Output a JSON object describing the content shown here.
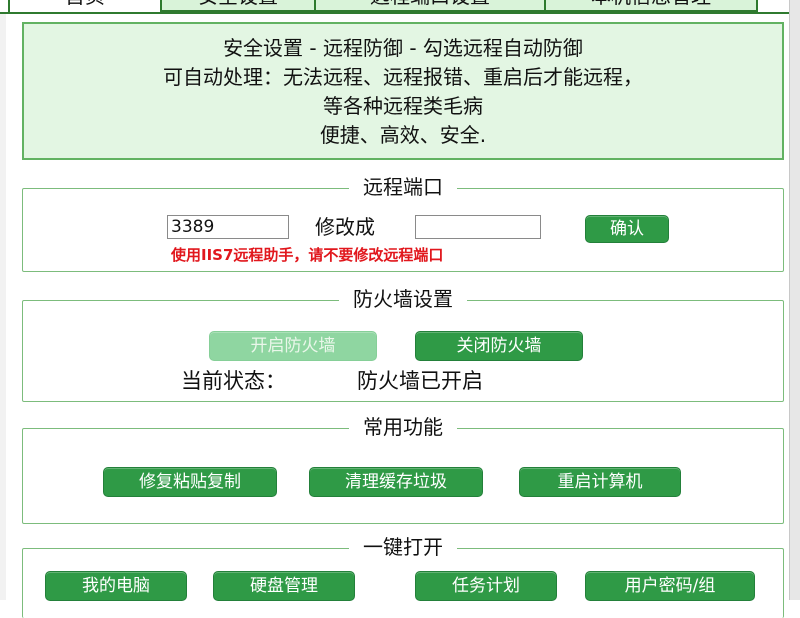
{
  "tabs": [
    {
      "label": "首页",
      "active": true
    },
    {
      "label": "安全设置",
      "active": false
    },
    {
      "label": "远程端口设置",
      "active": false
    },
    {
      "label": "本机信息管理",
      "active": false
    }
  ],
  "info": {
    "line1": "安全设置 - 远程防御 - 勾选远程自动防御",
    "line2": "可自动处理：无法远程、远程报错、重启后才能远程，",
    "line3": "等各种远程类毛病",
    "line4": "便捷、高效、安全."
  },
  "remote_port": {
    "title": "远程端口",
    "port_value": "3389",
    "modify_label": "修改成",
    "new_port_value": "",
    "confirm_label": "确认",
    "warning": "使用IIS7远程助手，请不要修改远程端口"
  },
  "firewall": {
    "title": "防火墙设置",
    "open_label": "开启防火墙",
    "close_label": "关闭防火墙",
    "status_label": "当前状态：",
    "status_value": "防火墙已开启"
  },
  "common": {
    "title": "常用功能",
    "buttons": [
      "修复粘贴复制",
      "清理缓存垃圾",
      "重启计算机"
    ]
  },
  "quick_open": {
    "title": "一键打开",
    "buttons": [
      "我的电脑",
      "硬盘管理",
      "任务计划",
      "用户密码/组"
    ]
  },
  "colors": {
    "accent_green": "#2f9a46",
    "panel_bg": "#e3f6e3",
    "warning_red": "#e1171d"
  }
}
